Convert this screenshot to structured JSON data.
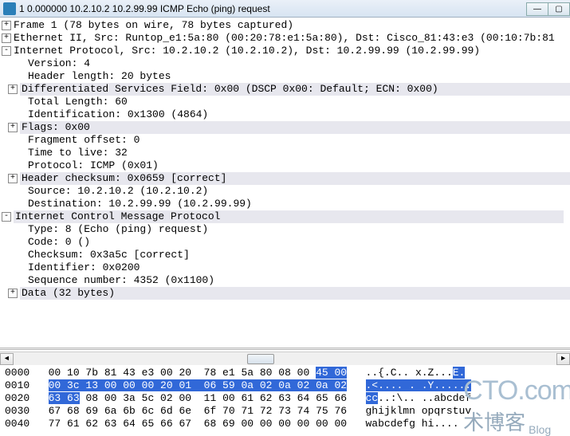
{
  "title": "1 0.000000 10.2.10.2 10.2.99.99 ICMP Echo (ping) request",
  "win": {
    "min": "—",
    "max": "▢"
  },
  "tree": [
    {
      "lvl": 0,
      "exp": "+",
      "band": false,
      "t": "Frame 1 (78 bytes on wire, 78 bytes captured)"
    },
    {
      "lvl": 0,
      "exp": "+",
      "band": false,
      "t": "Ethernet II, Src: Runtop_e1:5a:80 (00:20:78:e1:5a:80), Dst: Cisco_81:43:e3 (00:10:7b:81"
    },
    {
      "lvl": 0,
      "exp": "-",
      "band": false,
      "t": "Internet Protocol, Src: 10.2.10.2 (10.2.10.2), Dst: 10.2.99.99 (10.2.99.99)"
    },
    {
      "lvl": 1,
      "exp": "",
      "band": false,
      "t": "Version: 4"
    },
    {
      "lvl": 1,
      "exp": "",
      "band": false,
      "t": "Header length: 20 bytes"
    },
    {
      "lvl": 1,
      "exp": "+",
      "band": true,
      "t": "Differentiated Services Field: 0x00 (DSCP 0x00: Default; ECN: 0x00)"
    },
    {
      "lvl": 1,
      "exp": "",
      "band": false,
      "t": "Total Length: 60"
    },
    {
      "lvl": 1,
      "exp": "",
      "band": false,
      "t": "Identification: 0x1300 (4864)"
    },
    {
      "lvl": 1,
      "exp": "+",
      "band": true,
      "t": "Flags: 0x00"
    },
    {
      "lvl": 1,
      "exp": "",
      "band": false,
      "t": "Fragment offset: 0"
    },
    {
      "lvl": 1,
      "exp": "",
      "band": false,
      "t": "Time to live: 32"
    },
    {
      "lvl": 1,
      "exp": "",
      "band": false,
      "t": "Protocol: ICMP (0x01)"
    },
    {
      "lvl": 1,
      "exp": "+",
      "band": true,
      "t": "Header checksum: 0x0659 [correct]"
    },
    {
      "lvl": 1,
      "exp": "",
      "band": false,
      "t": "Source: 10.2.10.2 (10.2.10.2)"
    },
    {
      "lvl": 1,
      "exp": "",
      "band": false,
      "t": "Destination: 10.2.99.99 (10.2.99.99)"
    },
    {
      "lvl": 0,
      "exp": "-",
      "band": true,
      "t": "Internet Control Message Protocol"
    },
    {
      "lvl": 1,
      "exp": "",
      "band": false,
      "t": "Type: 8 (Echo (ping) request)"
    },
    {
      "lvl": 1,
      "exp": "",
      "band": false,
      "t": "Code: 0 ()"
    },
    {
      "lvl": 1,
      "exp": "",
      "band": false,
      "t": "Checksum: 0x3a5c [correct]"
    },
    {
      "lvl": 1,
      "exp": "",
      "band": false,
      "t": "Identifier: 0x0200"
    },
    {
      "lvl": 1,
      "exp": "",
      "band": false,
      "t": "Sequence number: 4352 (0x1100)"
    },
    {
      "lvl": 1,
      "exp": "+",
      "band": true,
      "t": "Data (32 bytes)"
    }
  ],
  "hex": {
    "lines": [
      {
        "off": "0000",
        "a": "00 10 7b 81 43 e3 00 20  78 e1 5a 80 08 00 ",
        "sel": "45 00",
        "b": "",
        "asc_a": "..{.C.. ",
        "asc_b": "x.Z...",
        "asc_sel": "E.",
        "asc_c": ""
      },
      {
        "off": "0010",
        "a": "",
        "sel": "00 3c 13 00 00 00 20 01  06 59 0a 02 0a 02 0a 02",
        "b": "",
        "asc_a": "",
        "asc_b": "",
        "asc_sel": ".<.... . .Y......",
        "asc_c": ""
      },
      {
        "off": "0020",
        "a": "",
        "sel": "63 63",
        "b": " 08 00 3a 5c 02 00  11 00 61 62 63 64 65 66",
        "asc_a": "",
        "asc_b": "",
        "asc_sel": "cc",
        "asc_c": "..:\\.. ..abcdef"
      },
      {
        "off": "0030",
        "a": "67 68 69 6a 6b 6c 6d 6e  6f 70 71 72 73 74 75 76",
        "sel": "",
        "b": "",
        "asc_a": "ghijklmn ",
        "asc_b": "opqrstuv",
        "asc_sel": "",
        "asc_c": ""
      },
      {
        "off": "0040",
        "a": "77 61 62 63 64 65 66 67  68 69 00 00 00 00 00 00",
        "sel": "",
        "b": "",
        "asc_a": "wabcdefg ",
        "asc_b": "hi....",
        "asc_sel": "",
        "asc_c": ""
      }
    ]
  },
  "wm": {
    "big": "CTO.com",
    "cn": "术博客",
    "blog": "Blog"
  }
}
